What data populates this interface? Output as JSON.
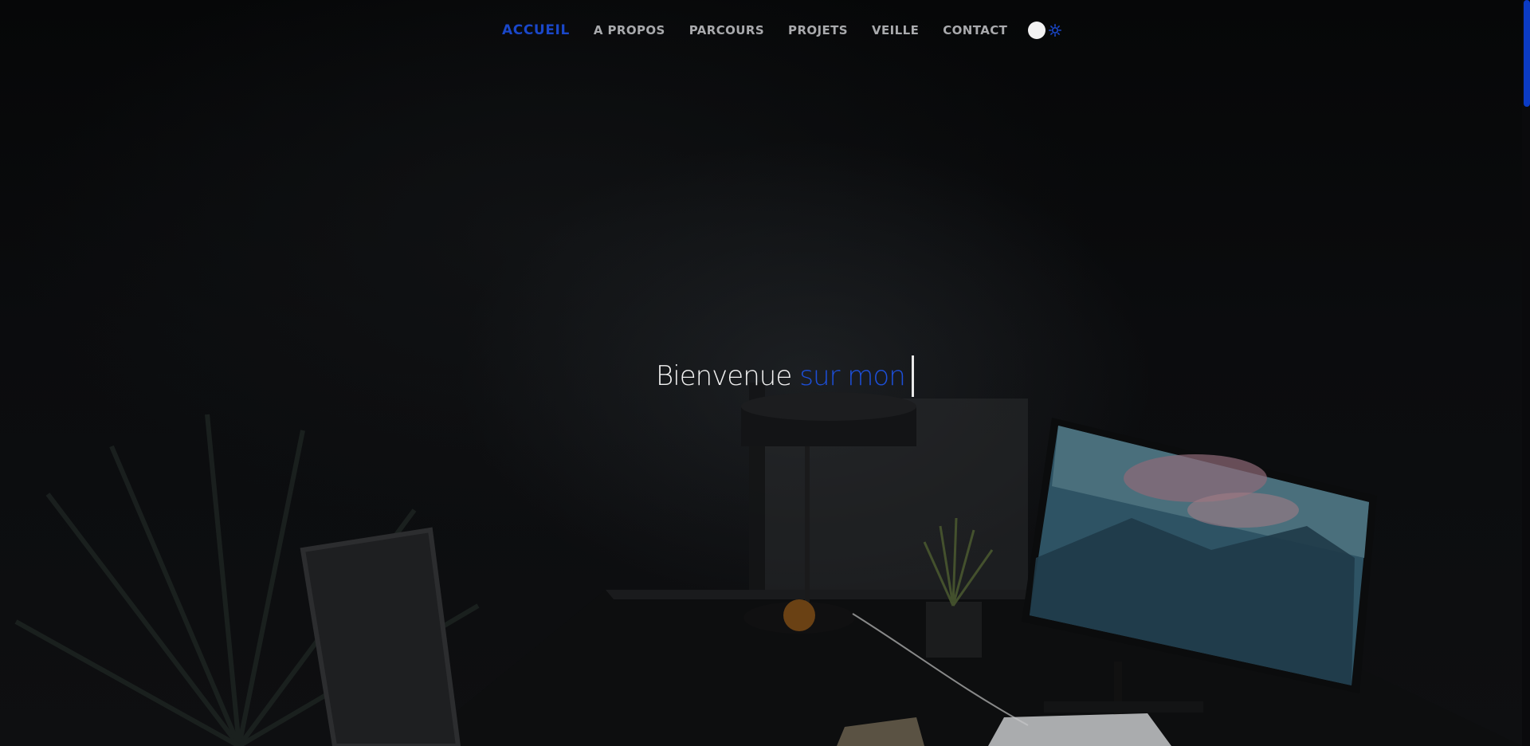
{
  "nav": {
    "items": [
      {
        "label": "ACCUEIL",
        "active": true
      },
      {
        "label": "A PROPOS",
        "active": false
      },
      {
        "label": "PARCOURS",
        "active": false
      },
      {
        "label": "PROJETS",
        "active": false
      },
      {
        "label": "VEILLE",
        "active": false
      },
      {
        "label": "CONTACT",
        "active": false
      }
    ],
    "theme_toggle_icon": "sun-icon"
  },
  "hero": {
    "headline_part1": "Bienvenue",
    "headline_part2": "sur mon"
  },
  "colors": {
    "accent": "#1a47c9",
    "nav_text": "#a9aaad",
    "background": "#070809",
    "headline_text": "#f1f1f1"
  }
}
